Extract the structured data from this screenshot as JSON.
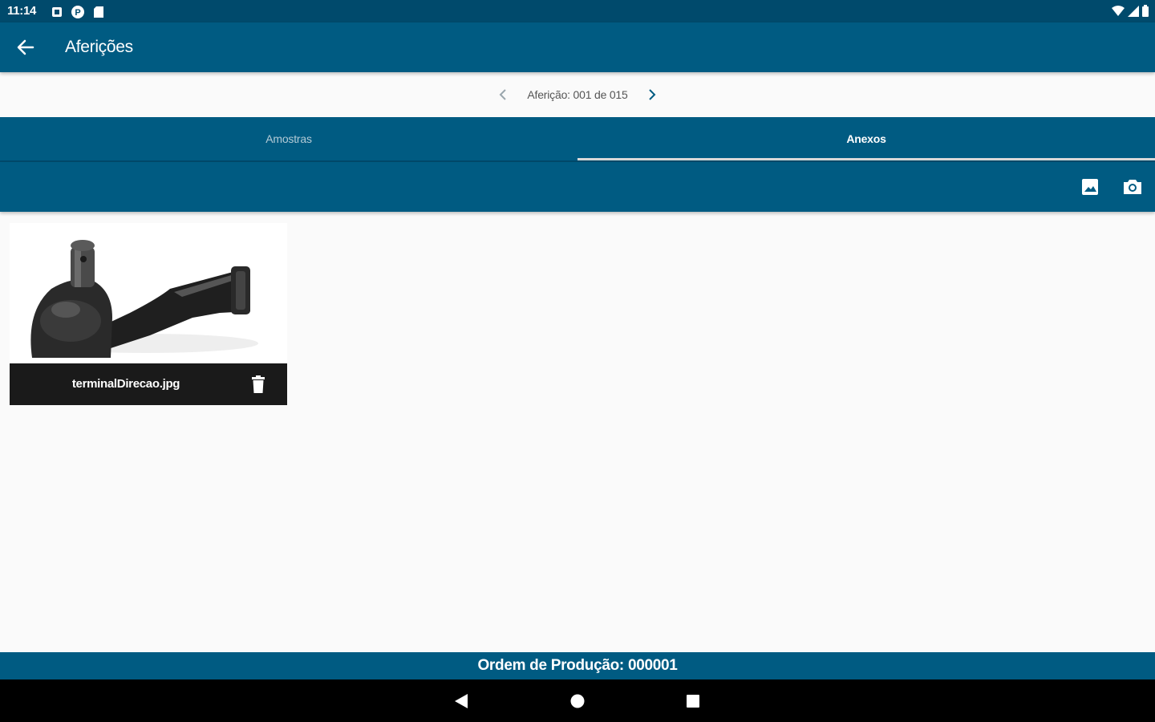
{
  "status_bar": {
    "time": "11:14"
  },
  "app_bar": {
    "title": "Aferições"
  },
  "pager": {
    "label": "Aferição: 001 de 015"
  },
  "tabs": [
    {
      "label": "Amostras",
      "selected": false
    },
    {
      "label": "Anexos",
      "selected": true
    }
  ],
  "attachments": [
    {
      "file_name": "terminalDirecao.jpg"
    }
  ],
  "footer": {
    "text": "Ordem de Produção: 000001"
  },
  "colors": {
    "primary": "#005b82",
    "primary_dark": "#004a6c",
    "background": "#fafafa"
  },
  "icons": {
    "back": "arrow-left-icon",
    "prev": "chevron-left-icon",
    "next": "chevron-right-icon",
    "gallery": "image-icon",
    "camera": "camera-icon",
    "delete": "trash-icon"
  }
}
